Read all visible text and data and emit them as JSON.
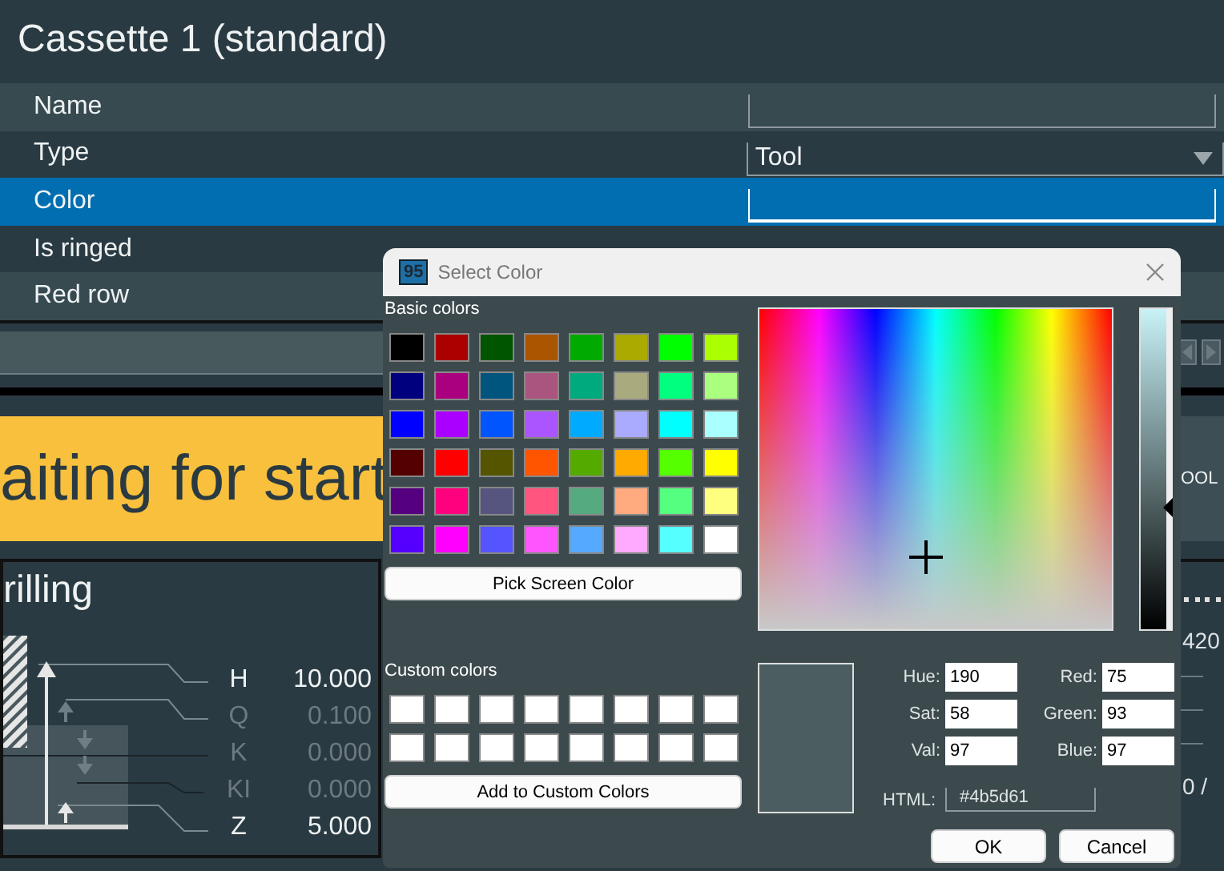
{
  "panel": {
    "title": "Cassette 1 (standard)",
    "rows": [
      {
        "label": "Name",
        "kind": "text",
        "selected": false
      },
      {
        "label": "Type",
        "kind": "dropdown",
        "value": "Tool",
        "selected": false
      },
      {
        "label": "Color",
        "kind": "text",
        "selected": true
      },
      {
        "label": "Is ringed",
        "kind": "none",
        "selected": false
      },
      {
        "label": "Red row",
        "kind": "none",
        "selected": false
      }
    ]
  },
  "status": {
    "text": "aiting for start"
  },
  "side": {
    "button": "OOL",
    "values": [
      "420",
      "0 /"
    ]
  },
  "cycle": {
    "title": "rilling",
    "params": [
      {
        "name": "H",
        "value": "10.000",
        "enabled": true
      },
      {
        "name": "Q",
        "value": "0.100",
        "enabled": false
      },
      {
        "name": "K",
        "value": "0.000",
        "enabled": false
      },
      {
        "name": "KI",
        "value": "0.000",
        "enabled": false
      },
      {
        "name": "Z",
        "value": "5.000",
        "enabled": true
      }
    ]
  },
  "dialog": {
    "app_icon": "95",
    "title": "Select Color",
    "basic_label": "Basic colors",
    "basic_colors": [
      {
        "color": "#000000"
      },
      {
        "color": "#aa0000"
      },
      {
        "color": "#005500"
      },
      {
        "color": "#aa5500"
      },
      {
        "color": "#00aa00"
      },
      {
        "color": "#aaaa00"
      },
      {
        "color": "#00ff00"
      },
      {
        "color": "#aaff00"
      },
      {
        "color": "#00007f"
      },
      {
        "color": "#aa007f"
      },
      {
        "color": "#00557f"
      },
      {
        "color": "#aa557f"
      },
      {
        "color": "#00aa7f"
      },
      {
        "color": "#aaaa7f"
      },
      {
        "color": "#00ff7f"
      },
      {
        "color": "#aaff7f"
      },
      {
        "color": "#0000ff"
      },
      {
        "color": "#aa00ff"
      },
      {
        "color": "#0055ff"
      },
      {
        "color": "#aa55ff"
      },
      {
        "color": "#00aaff"
      },
      {
        "color": "#aaaaff"
      },
      {
        "color": "#00ffff"
      },
      {
        "color": "#aaffff"
      },
      {
        "color": "#550000"
      },
      {
        "color": "#ff0000"
      },
      {
        "color": "#555500"
      },
      {
        "color": "#ff5500"
      },
      {
        "color": "#55aa00"
      },
      {
        "color": "#ffaa00"
      },
      {
        "color": "#55ff00"
      },
      {
        "color": "#ffff00"
      },
      {
        "color": "#55007f"
      },
      {
        "color": "#ff007f"
      },
      {
        "color": "#55557f"
      },
      {
        "color": "#ff557f"
      },
      {
        "color": "#55aa7f"
      },
      {
        "color": "#ffaa7f"
      },
      {
        "color": "#55ff7f"
      },
      {
        "color": "#ffff7f"
      },
      {
        "color": "#5500ff"
      },
      {
        "color": "#ff00ff"
      },
      {
        "color": "#5555ff"
      },
      {
        "color": "#ff55ff"
      },
      {
        "color": "#55aaff"
      },
      {
        "color": "#ffaaff"
      },
      {
        "color": "#55ffff"
      },
      {
        "color": "#ffffff"
      }
    ],
    "pick_button": "Pick Screen Color",
    "custom_label": "Custom colors",
    "custom_colors": [
      {
        "color": "#ffffff"
      },
      {
        "color": "#ffffff"
      },
      {
        "color": "#ffffff"
      },
      {
        "color": "#ffffff"
      },
      {
        "color": "#ffffff"
      },
      {
        "color": "#ffffff"
      },
      {
        "color": "#ffffff"
      },
      {
        "color": "#ffffff"
      },
      {
        "color": "#ffffff"
      },
      {
        "color": "#ffffff"
      },
      {
        "color": "#ffffff"
      },
      {
        "color": "#ffffff"
      },
      {
        "color": "#ffffff"
      },
      {
        "color": "#ffffff"
      },
      {
        "color": "#ffffff"
      },
      {
        "color": "#ffffff"
      }
    ],
    "add_button": "Add to Custom Colors",
    "value_slider": {
      "level": 0.38
    },
    "fields": [
      {
        "kind": "hue",
        "label": "Hue:",
        "value": "190"
      },
      {
        "kind": "red",
        "label": "Red:",
        "value": "75"
      },
      {
        "kind": "sat",
        "label": "Sat:",
        "value": "58"
      },
      {
        "kind": "green",
        "label": "Green:",
        "value": "93"
      },
      {
        "kind": "val",
        "label": "Val:",
        "value": "97"
      },
      {
        "kind": "blue",
        "label": "Blue:",
        "value": "97"
      }
    ],
    "html_label": "HTML:",
    "html_value": "#4b5d61",
    "buttons": [
      "OK",
      "Cancel"
    ]
  }
}
